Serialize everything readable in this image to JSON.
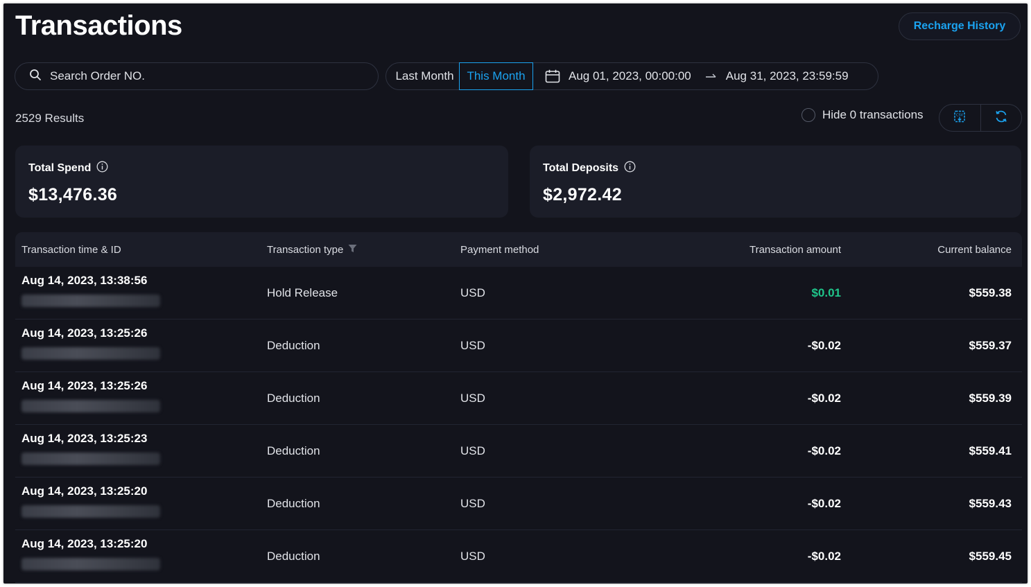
{
  "header": {
    "title": "Transactions",
    "recharge_history_label": "Recharge History"
  },
  "filters": {
    "search_placeholder": "Search Order NO.",
    "last_month_label": "Last Month",
    "this_month_label": "This Month",
    "selected_range": "This Month",
    "start_date": "Aug 01, 2023, 00:00:00",
    "end_date": "Aug 31, 2023, 23:59:59",
    "hide_zero_label": "Hide 0 transactions",
    "hide_zero_checked": false
  },
  "results_label": "2529 Results",
  "summary": {
    "total_spend_label": "Total Spend",
    "total_spend_value": "$13,476.36",
    "total_deposits_label": "Total Deposits",
    "total_deposits_value": "$2,972.42"
  },
  "table": {
    "columns": [
      "Transaction time & ID",
      "Transaction type",
      "Payment method",
      "Transaction amount",
      "Current balance"
    ],
    "rows": [
      {
        "time": "Aug 14, 2023, 13:38:56",
        "type": "Hold Release",
        "method": "USD",
        "amount": "$0.01",
        "balance": "$559.38"
      },
      {
        "time": "Aug 14, 2023, 13:25:26",
        "type": "Deduction",
        "method": "USD",
        "amount": "-$0.02",
        "balance": "$559.37"
      },
      {
        "time": "Aug 14, 2023, 13:25:26",
        "type": "Deduction",
        "method": "USD",
        "amount": "-$0.02",
        "balance": "$559.39"
      },
      {
        "time": "Aug 14, 2023, 13:25:23",
        "type": "Deduction",
        "method": "USD",
        "amount": "-$0.02",
        "balance": "$559.41"
      },
      {
        "time": "Aug 14, 2023, 13:25:20",
        "type": "Deduction",
        "method": "USD",
        "amount": "-$0.02",
        "balance": "$559.43"
      },
      {
        "time": "Aug 14, 2023, 13:25:20",
        "type": "Deduction",
        "method": "USD",
        "amount": "-$0.02",
        "balance": "$559.45"
      }
    ]
  },
  "icons": {
    "search": "search-icon",
    "calendar": "calendar-icon",
    "arrow": "arrow-right-icon",
    "export": "csv-export-icon",
    "refresh": "refresh-icon",
    "info": "info-icon",
    "filter": "filter-icon"
  },
  "colors": {
    "accent": "#1ba3f0",
    "positive_amount": "#1fc58a",
    "background": "#13141c",
    "card": "#1b1d28"
  }
}
